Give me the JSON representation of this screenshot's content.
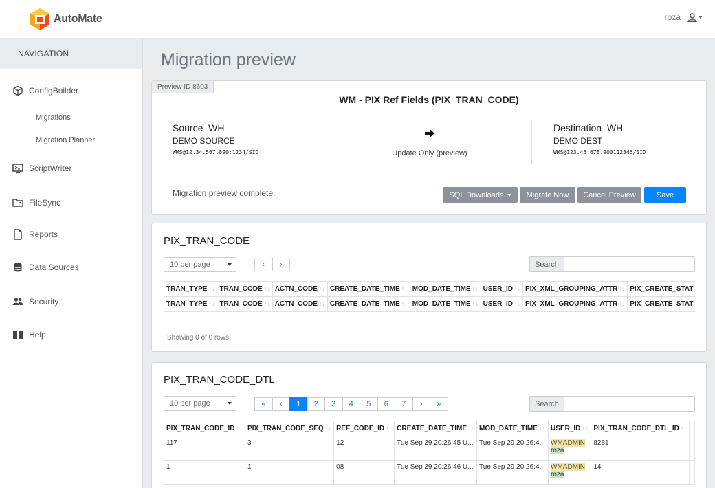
{
  "app": {
    "name": "AutoMate",
    "user": "roza"
  },
  "nav": {
    "heading": "NAVIGATION",
    "items": [
      {
        "label": "ConfigBuilder",
        "icon": "cube-icon"
      },
      {
        "label": "ScriptWriter",
        "icon": "script-icon"
      },
      {
        "label": "FileSync",
        "icon": "folder-sync-icon"
      },
      {
        "label": "Reports",
        "icon": "document-icon"
      },
      {
        "label": "Data Sources",
        "icon": "database-icon"
      },
      {
        "label": "Security",
        "icon": "users-icon"
      },
      {
        "label": "Help",
        "icon": "book-icon"
      }
    ],
    "subitems": [
      "Migrations",
      "Migration Planner"
    ]
  },
  "page": {
    "title": "Migration preview"
  },
  "preview": {
    "id_label": "Preview ID 8603",
    "title": "WM - PIX Ref Fields (PIX_TRAN_CODE)",
    "source": {
      "name": "Source_WH",
      "label": "DEMO SOURCE",
      "conn": "WMS@12.34.567.890:1234/SID"
    },
    "mode": "Update Only (preview)",
    "dest": {
      "name": "Destination_WH",
      "label": "DEMO DEST",
      "conn": "WMS@123.45.678.900112345/SID"
    },
    "status": "Migration preview complete.",
    "buttons": {
      "sql": "SQL Downloads",
      "migrate": "Migrate Now",
      "cancel": "Cancel Preview",
      "save": "Save"
    }
  },
  "table1": {
    "title": "PIX_TRAN_CODE",
    "per_page": "10 per page",
    "search_label": "Search",
    "columns": [
      "TRAN_TYPE",
      "TRAN_CODE",
      "ACTN_CODE",
      "CREATE_DATE_TIME",
      "MOD_DATE_TIME",
      "USER_ID",
      "PIX_XML_GROUPING_ATTR",
      "PIX_CREATE_STAT"
    ],
    "showing": "Showing 0 of 0 rows"
  },
  "table2": {
    "title": "PIX_TRAN_CODE_DTL",
    "per_page": "10 per page",
    "search_label": "Search",
    "pager": [
      "«",
      "‹",
      "1",
      "2",
      "3",
      "4",
      "5",
      "6",
      "7",
      "›",
      "»"
    ],
    "columns": [
      "PIX_TRAN_CODE_ID",
      "PIX_TRAN_CODE_SEQ",
      "REF_CODE_ID",
      "CREATE_DATE_TIME",
      "MOD_DATE_TIME",
      "USER_ID",
      "PIX_TRAN_CODE_DTL_ID"
    ],
    "rows": [
      {
        "c0": "117",
        "c1": "3",
        "c2": "12",
        "c3": "Tue Sep 29 20:26:45 U...",
        "c4": "Tue Sep 29 20:26:4...",
        "old": "WMADMIN",
        "new": "roza",
        "c6": "8281"
      },
      {
        "c0": "1",
        "c1": "1",
        "c2": "08",
        "c3": "Tue Sep 29 20:26:46 U...",
        "c4": "Tue Sep 29 20:26:4...",
        "old": "WMADMIN",
        "new": "roza",
        "c6": "14"
      }
    ]
  },
  "colors": {
    "accent": "#0a84ff",
    "logo_orange": "#f5a623",
    "logo_red": "#e94e1b"
  }
}
